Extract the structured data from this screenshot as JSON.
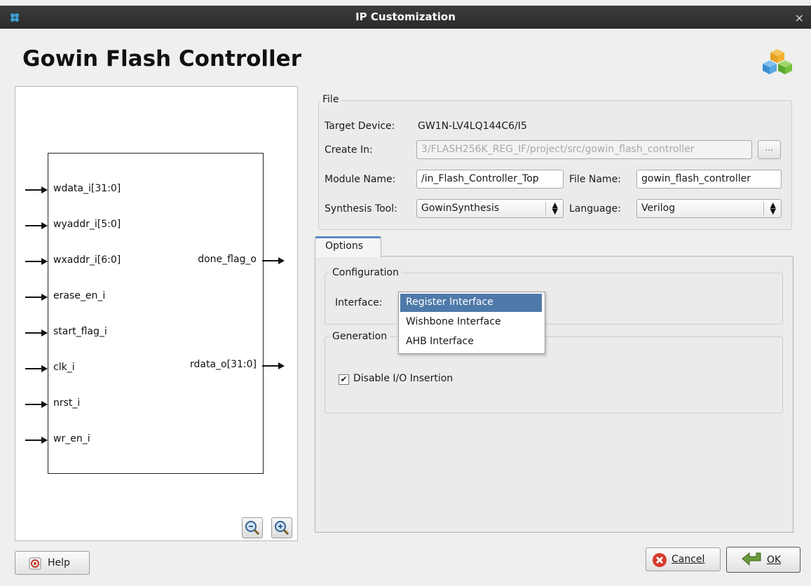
{
  "window": {
    "title": "IP Customization",
    "close_glyph": "×"
  },
  "heading": "Gowin Flash Controller",
  "symbol": {
    "inputs": [
      "wdata_i[31:0]",
      "wyaddr_i[5:0]",
      "wxaddr_i[6:0]",
      "erase_en_i",
      "start_flag_i",
      "clk_i",
      "nrst_i",
      "wr_en_i"
    ],
    "outputs": [
      "done_flag_o",
      "rdata_o[31:0]"
    ],
    "zoom_out_icon": "zoom-out-icon",
    "zoom_in_icon": "zoom-in-icon"
  },
  "file": {
    "group_title": "File",
    "target_device_label": "Target Device:",
    "target_device_value": "GW1N-LV4LQ144C6/I5",
    "create_in_label": "Create In:",
    "create_in_value": "3/FLASH256K_REG_IF/project/src/gowin_flash_controller",
    "browse_label": "...",
    "module_name_label": "Module Name:",
    "module_name_value": "/in_Flash_Controller_Top",
    "file_name_label": "File Name:",
    "file_name_value": "gowin_flash_controller",
    "synthesis_tool_label": "Synthesis Tool:",
    "synthesis_tool_value": "GowinSynthesis",
    "language_label": "Language:",
    "language_value": "Verilog"
  },
  "options": {
    "tab_label": "Options",
    "configuration_title": "Configuration",
    "interface_label": "Interface:",
    "interface_options": [
      "Register Interface",
      "Wishbone Interface",
      "AHB Interface"
    ],
    "interface_selected": "Register Interface",
    "generation_title": "Generation",
    "disable_io_label": "Disable I/O Insertion",
    "disable_io_checked": true
  },
  "buttons": {
    "help": "Help",
    "cancel": "Cancel",
    "ok": "OK"
  },
  "colors": {
    "selection": "#4e79aa",
    "tab_accent": "#5a8ac0",
    "cancel_icon": "#d83b2b",
    "ok_icon": "#6a9a3a"
  }
}
